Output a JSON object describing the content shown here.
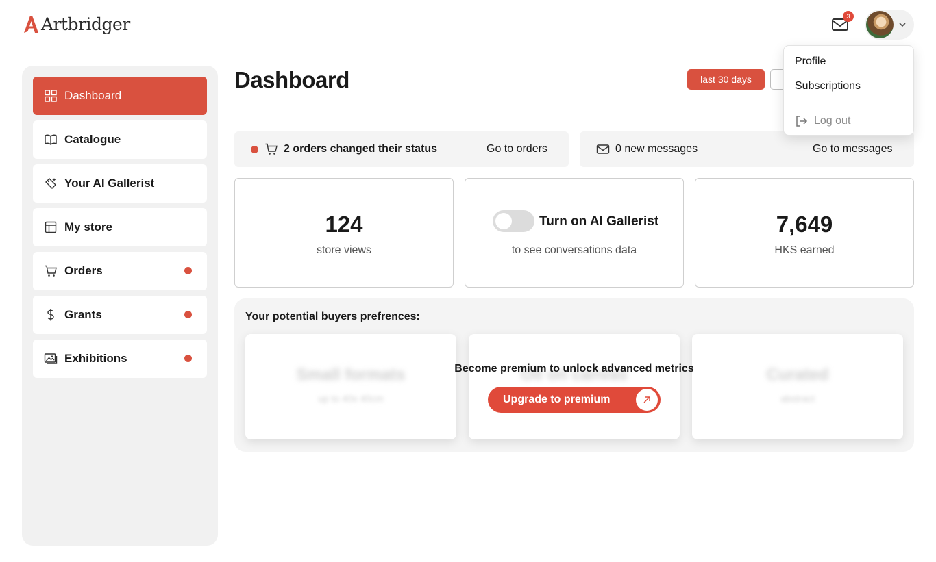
{
  "brand": {
    "name": "Artbridger",
    "accent": "#d9513f"
  },
  "header": {
    "mail_badge": "3",
    "mail_icon": "mail-icon",
    "chevron_icon": "chevron-down-icon"
  },
  "user_menu": {
    "profile": "Profile",
    "subscriptions": "Subscriptions",
    "logout": "Log out"
  },
  "sidebar": {
    "items": [
      {
        "label": "Dashboard",
        "icon": "grid-icon",
        "active": true,
        "dot": false
      },
      {
        "label": "Catalogue",
        "icon": "book-icon",
        "active": false,
        "dot": false
      },
      {
        "label": "Your AI Gallerist",
        "icon": "sparkle-tag-icon",
        "active": false,
        "dot": false
      },
      {
        "label": "My store",
        "icon": "layout-icon",
        "active": false,
        "dot": false
      },
      {
        "label": "Orders",
        "icon": "cart-icon",
        "active": false,
        "dot": true
      },
      {
        "label": "Grants",
        "icon": "dollar-icon",
        "active": false,
        "dot": true
      },
      {
        "label": "Exhibitions",
        "icon": "gallery-icon",
        "active": false,
        "dot": true
      }
    ]
  },
  "main": {
    "title": "Dashboard",
    "range_selected": "last 30 days",
    "orders_notice": {
      "text": "2 orders changed their status",
      "link": "Go to orders"
    },
    "messages_notice": {
      "text": "0 new messages",
      "link": "Go to messages"
    },
    "stats": {
      "views": {
        "value": "124",
        "label": "store views"
      },
      "ai": {
        "label": "Turn on AI Gallerist",
        "sub": "to see conversations data",
        "enabled": false
      },
      "earned": {
        "value": "7,649",
        "label": "HKS earned"
      }
    },
    "prefs": {
      "title": "Your potential buyers prefrences:",
      "cards": [
        {
          "title": "Small formats",
          "sub": "up to 40x 40cm"
        },
        {
          "title": "Oil on canvas",
          "sub": ""
        },
        {
          "title": "Curated",
          "sub": "abstract"
        }
      ],
      "premium_message": "Become premium to unlock advanced metrics",
      "upgrade_label": "Upgrade to premium"
    }
  }
}
